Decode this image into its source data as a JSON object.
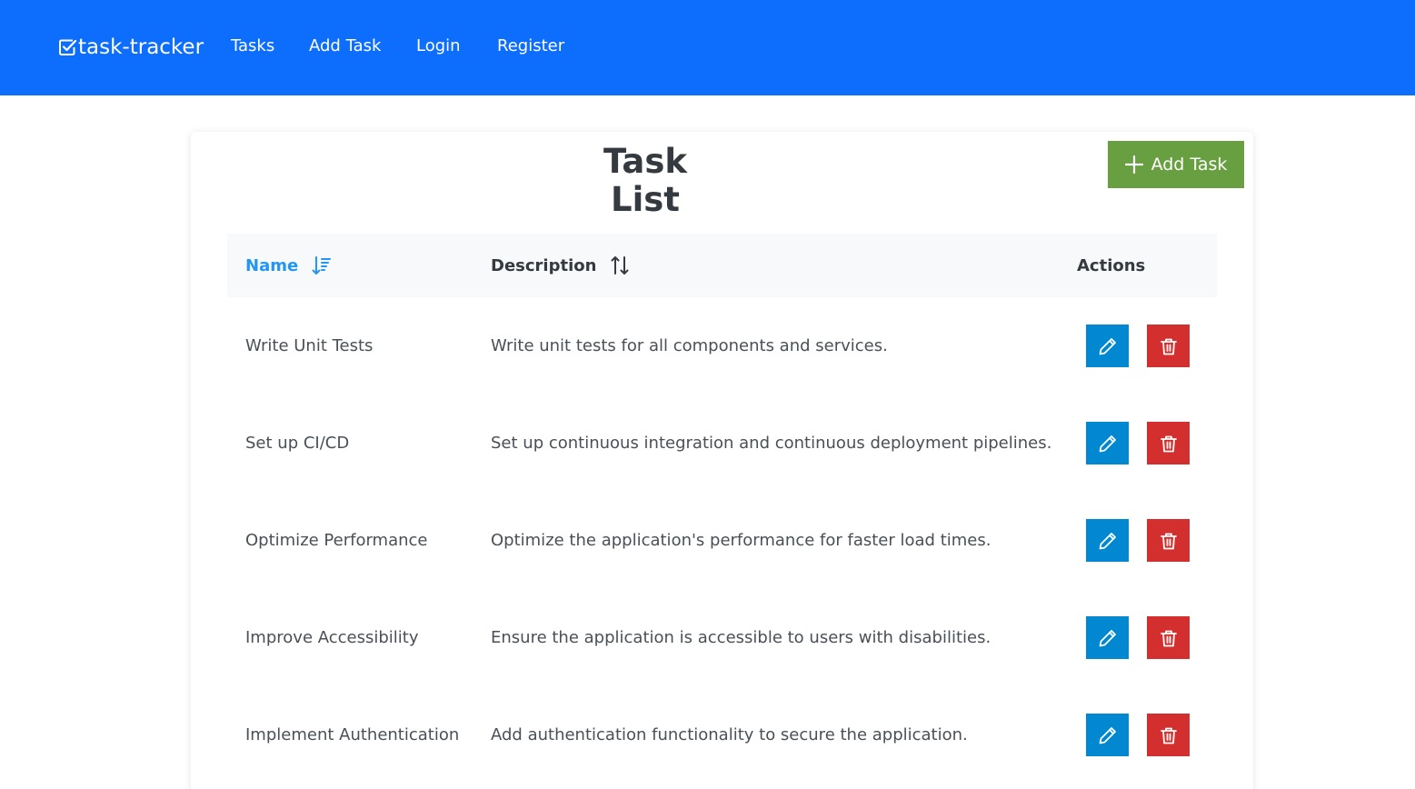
{
  "navbar": {
    "brand": "task-tracker",
    "brand_icon": "check-square-icon",
    "links": [
      "Tasks",
      "Add Task",
      "Login",
      "Register"
    ],
    "color": "#0d6efd"
  },
  "card": {
    "title": "Task List",
    "add_button_label": "Add Task",
    "add_button_icon": "plus-icon",
    "add_button_color": "#68a041"
  },
  "table": {
    "headers": {
      "name": "Name",
      "description": "Description",
      "actions": "Actions"
    },
    "name_sort_icon": "sort-descending-icon",
    "description_sort_icon": "sort-both-icon",
    "active_sort_color": "#2196f3",
    "rows": [
      {
        "name": "Write Unit Tests",
        "description": "Write unit tests for all components and services."
      },
      {
        "name": "Set up CI/CD",
        "description": "Set up continuous integration and continuous deployment pipelines."
      },
      {
        "name": "Optimize Performance",
        "description": "Optimize the application's performance for faster load times."
      },
      {
        "name": "Improve Accessibility",
        "description": "Ensure the application is accessible to users with disabilities."
      },
      {
        "name": "Implement Authentication",
        "description": "Add authentication functionality to secure the application."
      }
    ],
    "edit_icon": "pencil-icon",
    "delete_icon": "trash-icon",
    "edit_color": "#0288d1",
    "delete_color": "#d32f2f"
  }
}
